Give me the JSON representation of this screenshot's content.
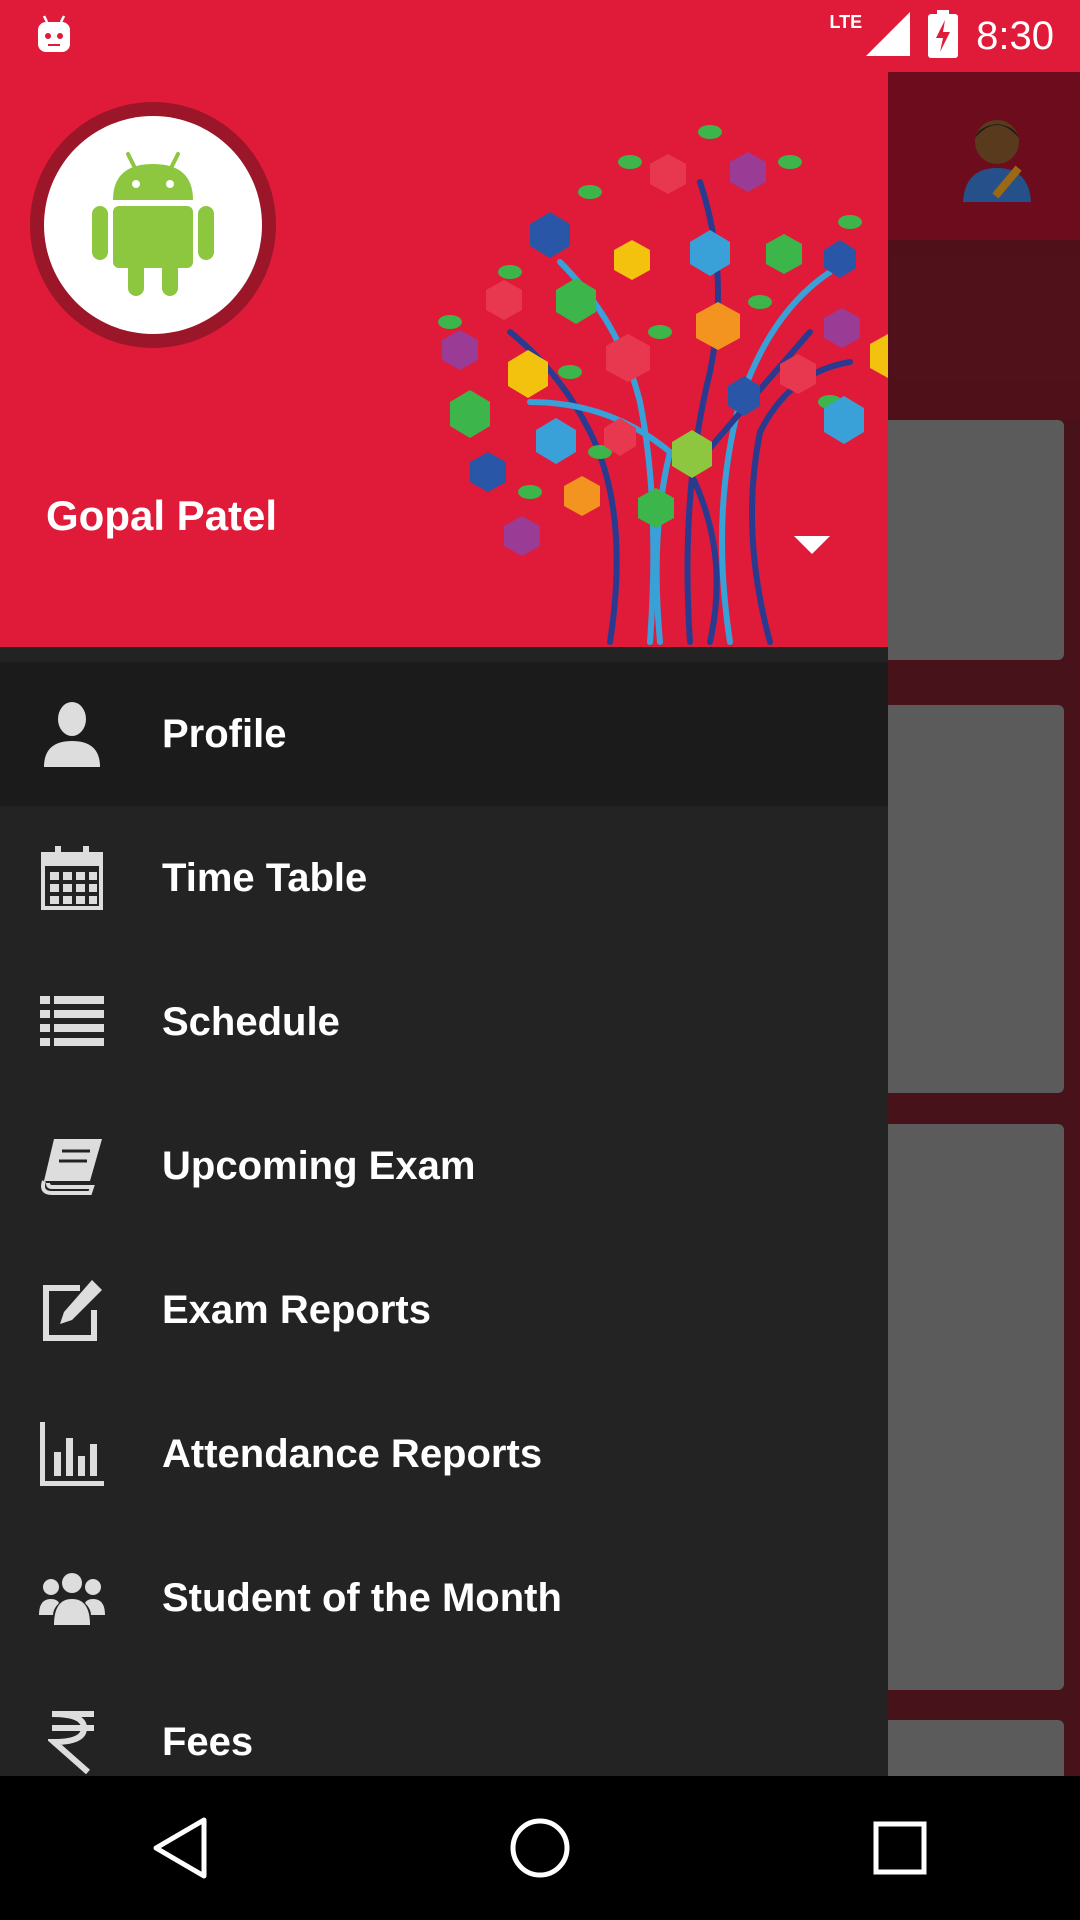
{
  "status_bar": {
    "network": "LTE",
    "time": "8:30"
  },
  "drawer": {
    "user_name": "Gopal Patel",
    "menu": [
      {
        "label": "Profile",
        "icon": "person-icon",
        "active": true
      },
      {
        "label": "Time Table",
        "icon": "calendar-icon",
        "active": false
      },
      {
        "label": "Schedule",
        "icon": "list-icon",
        "active": false
      },
      {
        "label": "Upcoming Exam",
        "icon": "book-icon",
        "active": false
      },
      {
        "label": "Exam Reports",
        "icon": "edit-icon",
        "active": false
      },
      {
        "label": "Attendance Reports",
        "icon": "bar-chart-icon",
        "active": false
      },
      {
        "label": "Student of the Month",
        "icon": "group-icon",
        "active": false
      },
      {
        "label": "Fees",
        "icon": "rupee-icon",
        "active": false
      }
    ]
  },
  "nav_bar": {
    "buttons": [
      "back",
      "home",
      "recents"
    ]
  },
  "colors": {
    "primary": "#e01b3a",
    "drawer_bg": "#232323",
    "active_item_bg": "#1b1b1b"
  }
}
